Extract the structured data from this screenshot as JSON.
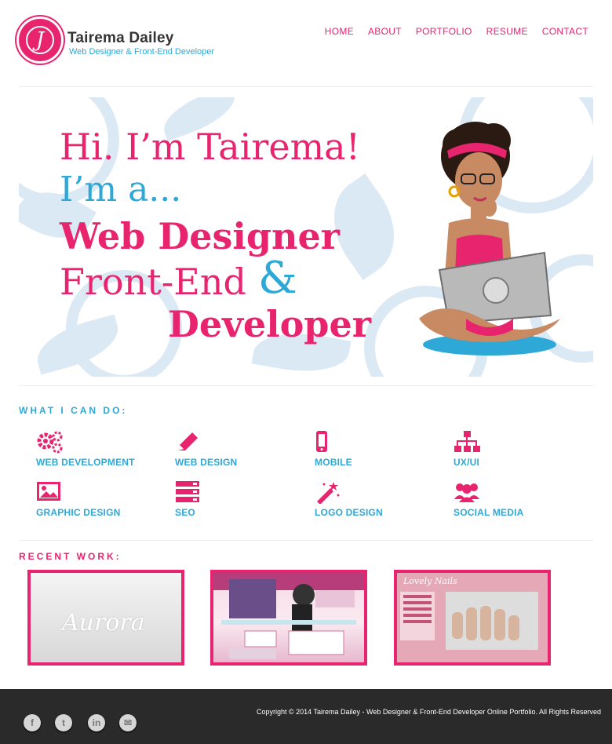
{
  "header": {
    "logo_letter": "J",
    "name": "Tairema Dailey",
    "tagline": "Web Designer & Front-End Developer",
    "nav": [
      "HOME",
      "ABOUT",
      "PORTFOLIO",
      "RESUME",
      "CONTACT"
    ]
  },
  "hero": {
    "line1": "Hi. I’m Tairema!",
    "line2": "I’m a...",
    "line3": "Web Designer",
    "line4": "Front-End",
    "ampersand": "&",
    "line5": "Developer"
  },
  "services": {
    "title": "WHAT I CAN DO:",
    "items": [
      {
        "label": "WEB DEVELOPMENT",
        "icon": "gears-icon"
      },
      {
        "label": "WEB DESIGN",
        "icon": "pencil-icon"
      },
      {
        "label": "MOBILE",
        "icon": "mobile-icon"
      },
      {
        "label": "UX/UI",
        "icon": "sitemap-icon"
      },
      {
        "label": "GRAPHIC DESIGN",
        "icon": "picture-icon"
      },
      {
        "label": "SEO",
        "icon": "server-icon"
      },
      {
        "label": "LOGO DESIGN",
        "icon": "magic-wand-icon"
      },
      {
        "label": "SOCIAL MEDIA",
        "icon": "users-icon"
      }
    ]
  },
  "recent_work": {
    "title": "RECENT WORK:",
    "thumb1_text": "Aurora",
    "thumb3_text": "Lovely Nails"
  },
  "footer": {
    "social": [
      {
        "icon": "facebook-icon",
        "glyph": "f"
      },
      {
        "icon": "twitter-icon",
        "glyph": "t"
      },
      {
        "icon": "linkedin-icon",
        "glyph": "in"
      },
      {
        "icon": "email-icon",
        "glyph": "✉"
      }
    ],
    "copyright": "Copyright © 2014 Tairema Dailey - Web Designer & Front-End Developer Online Portfolio. All Rights Reserved"
  },
  "colors": {
    "accent": "#e8246e",
    "secondary": "#2ea8d6",
    "footer_bg": "#2a2a2a"
  }
}
